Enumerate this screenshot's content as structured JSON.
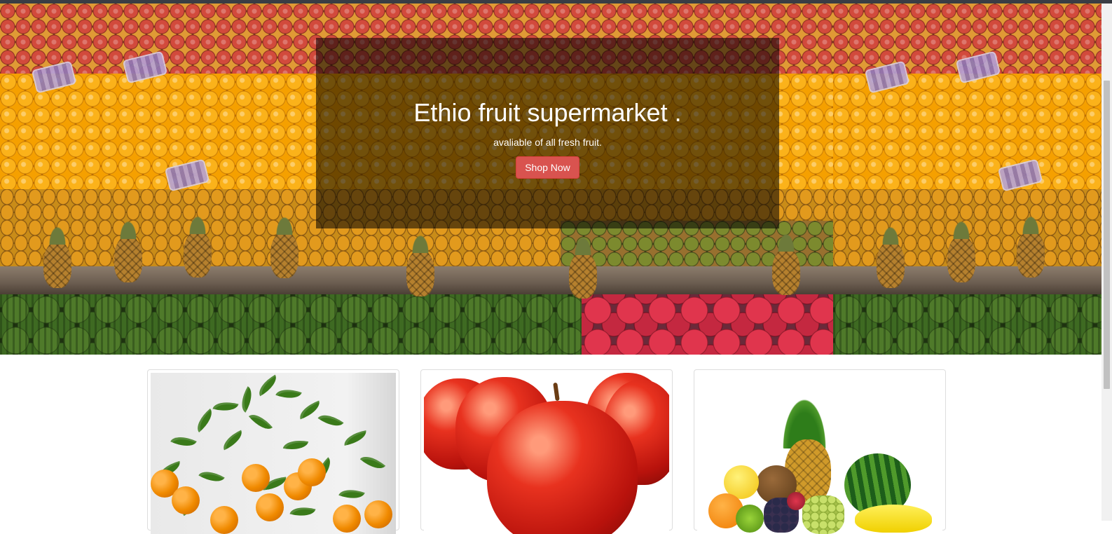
{
  "hero": {
    "title": "Ethio fruit supermarket .",
    "subtitle": "avaliable of all fresh fruit.",
    "cta_label": "Shop Now"
  },
  "products": [
    {
      "image": "orange-tree-photo"
    },
    {
      "image": "red-apples-photo"
    },
    {
      "image": "mixed-fruit-photo"
    }
  ],
  "colors": {
    "cta": "#d9534f",
    "panel_overlay": "rgba(0,0,0,0.55)",
    "card_border": "#dddddd"
  }
}
